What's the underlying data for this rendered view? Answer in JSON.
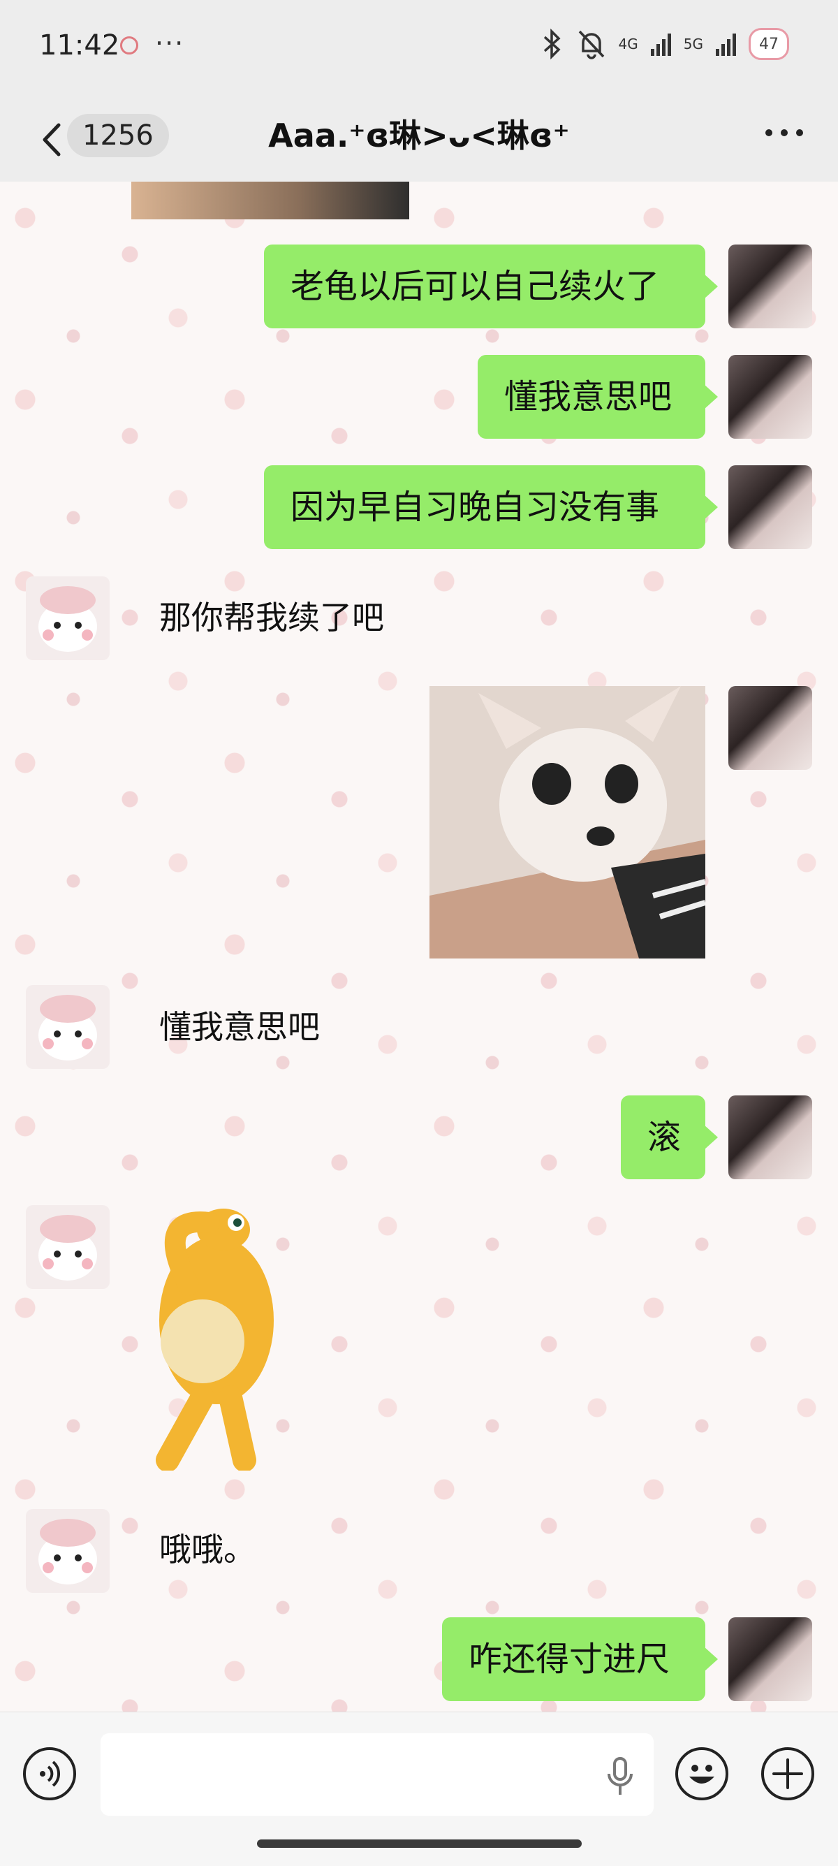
{
  "status_bar": {
    "time": "11:42",
    "dots": "···",
    "network_a": "4G",
    "network_b": "5G",
    "battery": "47"
  },
  "header": {
    "unread_count": "1256",
    "title": "Aaa.⁺ɞ琳>ᴗ<琳ɞ⁺"
  },
  "messages": [
    {
      "side": "right",
      "kind": "text",
      "text": "老龟以后可以自己续火了"
    },
    {
      "side": "right",
      "kind": "text",
      "text": "懂我意思吧"
    },
    {
      "side": "right",
      "kind": "text",
      "text": "因为早自习晚自习没有事"
    },
    {
      "side": "left",
      "kind": "text",
      "text": "那你帮我续了吧"
    },
    {
      "side": "right",
      "kind": "image",
      "text": "chihuahua-sticker"
    },
    {
      "side": "left",
      "kind": "text",
      "text": "懂我意思吧"
    },
    {
      "side": "right",
      "kind": "text",
      "text": "滚"
    },
    {
      "side": "left",
      "kind": "image",
      "text": "yellow-creature-sticker"
    },
    {
      "side": "left",
      "kind": "text",
      "text": "哦哦。"
    },
    {
      "side": "right",
      "kind": "text",
      "text": "咋还得寸进尺"
    }
  ],
  "colors": {
    "bubble": "#95ec69",
    "header_bg": "#ededed",
    "chat_bg": "#fbf7f6"
  },
  "icons": [
    "back-chevron-icon",
    "more-dots-icon",
    "voice-icon",
    "microphone-icon",
    "emoji-icon",
    "plus-icon",
    "bluetooth-icon",
    "mute-bell-icon"
  ]
}
